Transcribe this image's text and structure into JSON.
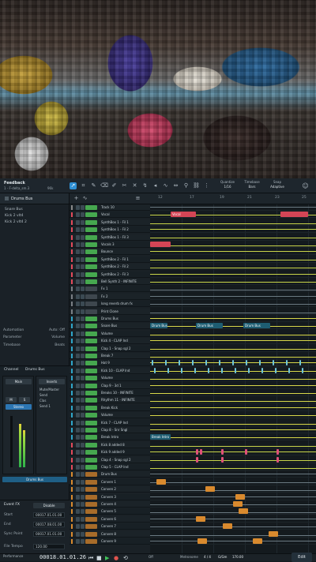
{
  "header": {
    "song_title": "Feedback",
    "song_subtitle": "1 - F-delta_sm.3",
    "song_rate": "96k",
    "quantize_label": "Quantize",
    "quantize_value": "1/16",
    "timebase_label": "Timebase",
    "timebase_value": "Bars",
    "snap_label": "Snap",
    "snap_value": "Adaptive"
  },
  "inspector": {
    "channel_title": "Drums Bus",
    "tree": [
      "Snare Bus",
      "Kick 2 vlt4",
      "Kick 2 vlt4 2"
    ],
    "automation_label": "Automation",
    "automation_value": "Auto: Off",
    "parameter_label": "Parameter",
    "parameter_value": "Volume",
    "timebase_label": "Timebase",
    "timebase_value": "Beats"
  },
  "mixer": {
    "channel_label": "Channel",
    "channel_value": "Drums Bus",
    "mode_label": "Main",
    "insert_label": "Inserts",
    "inserts": [
      "Mute/Master",
      "Send",
      "Clas",
      "Send 1"
    ],
    "channel_name": "Drums Bus"
  },
  "event": {
    "section_title": "Event FX",
    "disable_label": "Disable",
    "start_label": "Start",
    "start_value": "00017.01.01.00",
    "end_label": "End",
    "end_value": "00017.08.01.00",
    "sync_label": "Sync Point",
    "sync_value": "00017.01.01.00",
    "timebase_label": "File Tempo",
    "timebase_value": "120.00"
  },
  "ruler": [
    "12",
    "17",
    "19",
    "21",
    "23",
    "25"
  ],
  "tracks": [
    {
      "name": "Track 10",
      "color": "#8a8a8a"
    },
    {
      "name": "Vocal",
      "color": "#e34a5b"
    },
    {
      "name": "SynthBox 1 - Fil 1",
      "color": "#e34a5b"
    },
    {
      "name": "SynthBox 1 - Fil 2",
      "color": "#e34a5b"
    },
    {
      "name": "SynthBox 1 - Fil 3",
      "color": "#e34a5b"
    },
    {
      "name": "Vocals 3",
      "color": "#e34a5b"
    },
    {
      "name": "Bounce",
      "color": "#e34a5b"
    },
    {
      "name": "SynthBox 2 - Fil 1",
      "color": "#e34a5b"
    },
    {
      "name": "SynthBox 2 - Fil 2",
      "color": "#e34a5b"
    },
    {
      "name": "SynthBox 2 - Fil 3",
      "color": "#e34a5b"
    },
    {
      "name": "Bell Synth 2 - INFINITE",
      "color": "#e34a5b"
    },
    {
      "name": "Fx 1",
      "color": "#7a7f85"
    },
    {
      "name": "Fx 2",
      "color": "#7a7f85"
    },
    {
      "name": "long reverb drum fx",
      "color": "#7a7f85"
    },
    {
      "name": "Print Clone",
      "color": "#7a7f85"
    },
    {
      "name": "Drums Bus",
      "color": "#2fa6c9"
    },
    {
      "name": "Snare Bus",
      "color": "#2fa6c9"
    },
    {
      "name": "Volume",
      "color": "#2fa6c9"
    },
    {
      "name": "Kick 4 - CLAP Ind",
      "color": "#2fa6c9"
    },
    {
      "name": "Clap 1 - Snap sgl 2",
      "color": "#2fa6c9"
    },
    {
      "name": "Break 7",
      "color": "#2fa6c9"
    },
    {
      "name": "Hat 9",
      "color": "#2fa6c9"
    },
    {
      "name": "Kick 10 - CLAP Ind",
      "color": "#2fa6c9"
    },
    {
      "name": "Volume",
      "color": "#2fa6c9"
    },
    {
      "name": "Clap 9 - 3d 1",
      "color": "#2fa6c9"
    },
    {
      "name": "Breaks 10 - INFINITE",
      "color": "#2fa6c9"
    },
    {
      "name": "Rhythm 11 - INFINITE",
      "color": "#2fa6c9"
    },
    {
      "name": "Break Kick",
      "color": "#2fa6c9"
    },
    {
      "name": "Volume",
      "color": "#2fa6c9"
    },
    {
      "name": "Kick 7 - CLAP Ind",
      "color": "#2fa6c9"
    },
    {
      "name": "Clap 8 - Snr Sngl",
      "color": "#2fa6c9"
    },
    {
      "name": "Break Intro",
      "color": "#2fa6c9"
    },
    {
      "name": "Kick 8 added 8",
      "color": "#e34a5b"
    },
    {
      "name": "Kick 9 added 9",
      "color": "#e34a5b"
    },
    {
      "name": "Clap 4 - Snap sgl 2",
      "color": "#e34a5b"
    },
    {
      "name": "Clap 5 - CLAP Ind",
      "color": "#e34a5b"
    },
    {
      "name": "Drum Bus",
      "color": "#d98a2e"
    },
    {
      "name": "Conven 1",
      "color": "#d98a2e"
    },
    {
      "name": "Conven 2",
      "color": "#d98a2e"
    },
    {
      "name": "Conven 3",
      "color": "#d98a2e"
    },
    {
      "name": "Conven 4",
      "color": "#d98a2e"
    },
    {
      "name": "Conven 5",
      "color": "#d98a2e"
    },
    {
      "name": "Conven 6",
      "color": "#d98a2e"
    },
    {
      "name": "Conven 7",
      "color": "#d98a2e"
    },
    {
      "name": "Conven 8",
      "color": "#d98a2e"
    },
    {
      "name": "Conven 9",
      "color": "#d98a2e"
    }
  ],
  "clips": {
    "vocal_clip": "Vocal",
    "drum_bus_clip_1": "Drum Bus",
    "drum_bus_clip_2": "Drum Bus",
    "drum_bus_clip_3": "Drum Bus",
    "break_intro_clip": "Break Intro"
  },
  "transport": {
    "time": "00018.01.01.26",
    "time_sub": "Bars 18",
    "performance_label": "Performance",
    "sig": "4 / 4",
    "key": "G/Gm",
    "tempo": "170.00",
    "sig_label": "Timing",
    "key_label": "Key",
    "tempo_label": "Tempo",
    "metronome_label": "Metronome",
    "sync_label": "Sync",
    "off_label": "Off",
    "edit_label": "Edit"
  }
}
